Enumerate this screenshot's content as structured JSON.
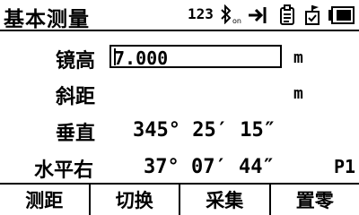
{
  "header": {
    "title": "基本测量",
    "mode_number": "123",
    "bluetooth_state": "on",
    "icons": [
      "bluetooth-icon",
      "enter-arrow-icon",
      "clipboard-icon",
      "flag-icon",
      "battery-icon"
    ]
  },
  "fields": {
    "height": {
      "label": "镜高",
      "value": "7.000",
      "unit": "m"
    },
    "slope_distance": {
      "label": "斜距",
      "value": "",
      "unit": "m"
    },
    "vertical": {
      "label": "垂直",
      "value": "345° 25′ 15″"
    },
    "horizontal": {
      "label": "水平右",
      "value": "37° 07′ 44″"
    }
  },
  "page_indicator": "P1",
  "softkeys": [
    "测距",
    "切换",
    "采集",
    "置零"
  ]
}
